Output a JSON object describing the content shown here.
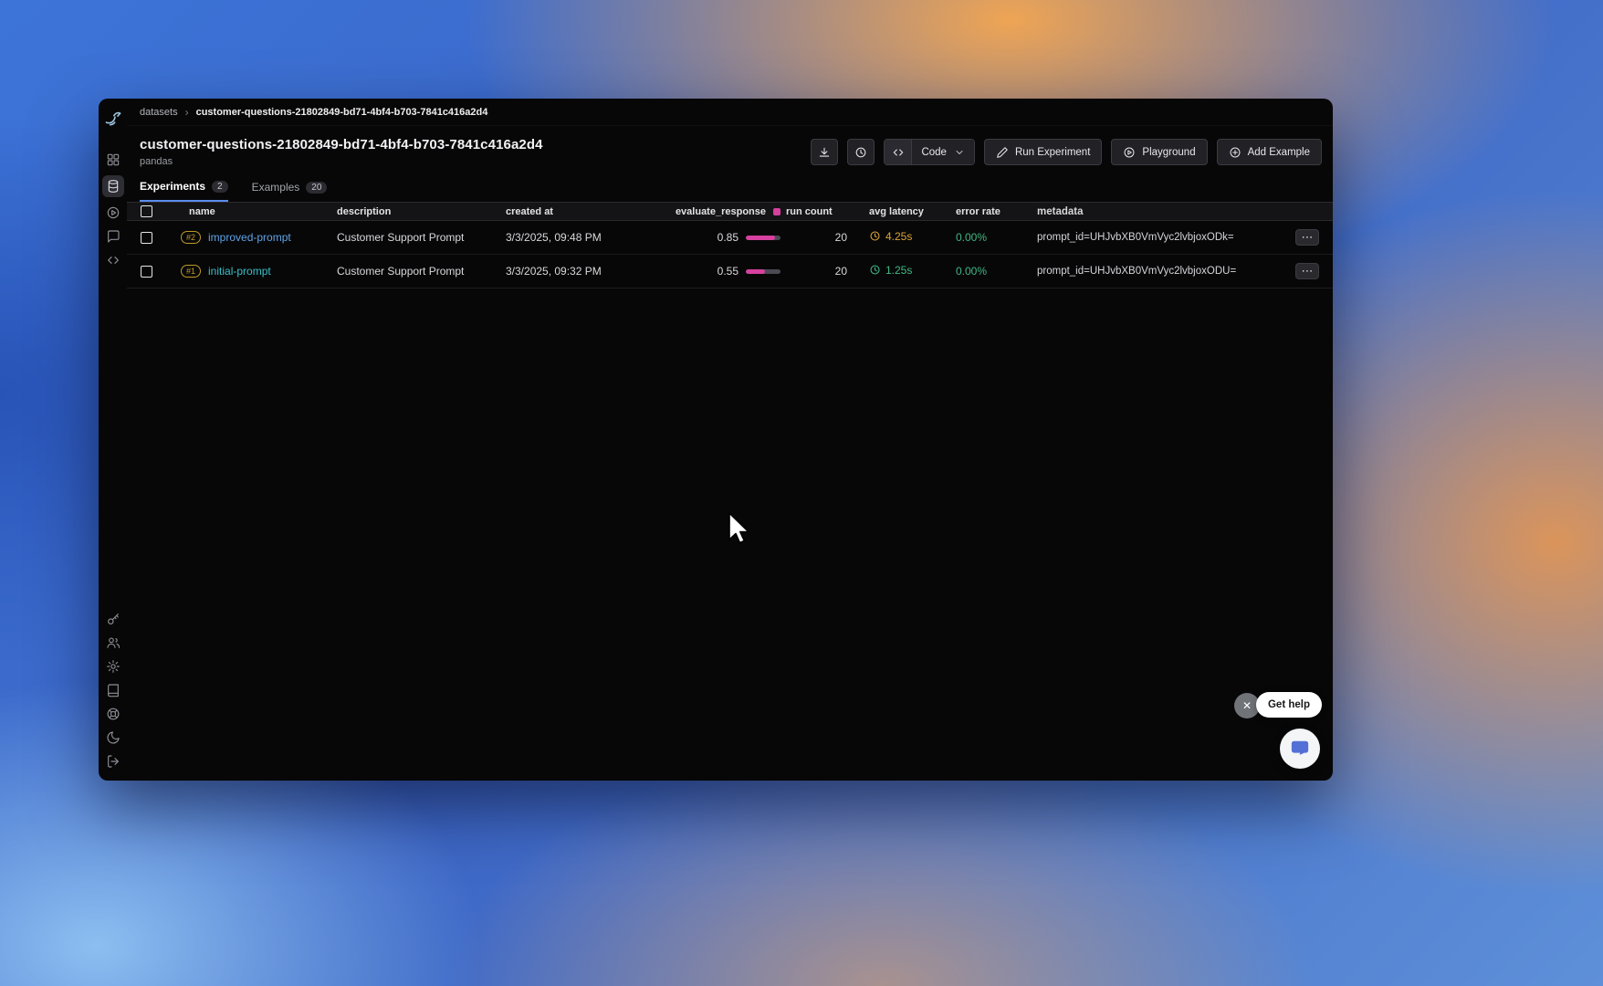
{
  "breadcrumb": {
    "root": "datasets",
    "separator": "›",
    "current": "customer-questions-21802849-bd71-4bf4-b703-7841c416a2d4"
  },
  "header": {
    "title": "customer-questions-21802849-bd71-4bf4-b703-7841c416a2d4",
    "subtitle": "pandas"
  },
  "toolbar": {
    "code_label": "Code",
    "run_experiment_label": "Run Experiment",
    "playground_label": "Playground",
    "add_example_label": "Add Example"
  },
  "tabs": {
    "experiments": {
      "label": "Experiments",
      "count": "2"
    },
    "examples": {
      "label": "Examples",
      "count": "20"
    }
  },
  "table": {
    "headers": {
      "name": "name",
      "description": "description",
      "created_at": "created at",
      "evaluate_response": "evaluate_response",
      "run_count": "run count",
      "avg_latency": "avg latency",
      "error_rate": "error rate",
      "metadata": "metadata"
    },
    "eval_swatch_color": "#d6409f",
    "eval_bar_fill": "#d6409f",
    "eval_bar_track": "#4a4a52",
    "actions_glyph": "⋯",
    "rows": [
      {
        "badge": "#2",
        "badge_color": "#c9a227",
        "name": "improved-prompt",
        "name_color": "#5fa3e6",
        "description": "Customer Support Prompt",
        "created_at": "3/3/2025, 09:48 PM",
        "evaluate_response": "0.85",
        "evaluate_pct": "85%",
        "run_count": "20",
        "avg_latency": "4.25s",
        "latency_color": "#d9a43a",
        "error_rate": "0.00%",
        "error_color": "#41b883",
        "metadata": "prompt_id=UHJvbXB0VmVyc2lvbjoxODk="
      },
      {
        "badge": "#1",
        "badge_color": "#c9a227",
        "name": "initial-prompt",
        "name_color": "#3cbec6",
        "description": "Customer Support Prompt",
        "created_at": "3/3/2025, 09:32 PM",
        "evaluate_response": "0.55",
        "evaluate_pct": "55%",
        "run_count": "20",
        "avg_latency": "1.25s",
        "latency_color": "#41b883",
        "error_rate": "0.00%",
        "error_color": "#41b883",
        "metadata": "prompt_id=UHJvbXB0VmVyc2lvbjoxODU="
      }
    ]
  },
  "sidebar": {
    "top_icons": [
      "apps",
      "database",
      "play-circle",
      "message",
      "code"
    ],
    "bottom_icons": [
      "key",
      "users",
      "gear",
      "book",
      "help",
      "moon",
      "logout"
    ],
    "selected": "database"
  },
  "overlay": {
    "close_glyph": "✕",
    "get_help_label": "Get help"
  }
}
